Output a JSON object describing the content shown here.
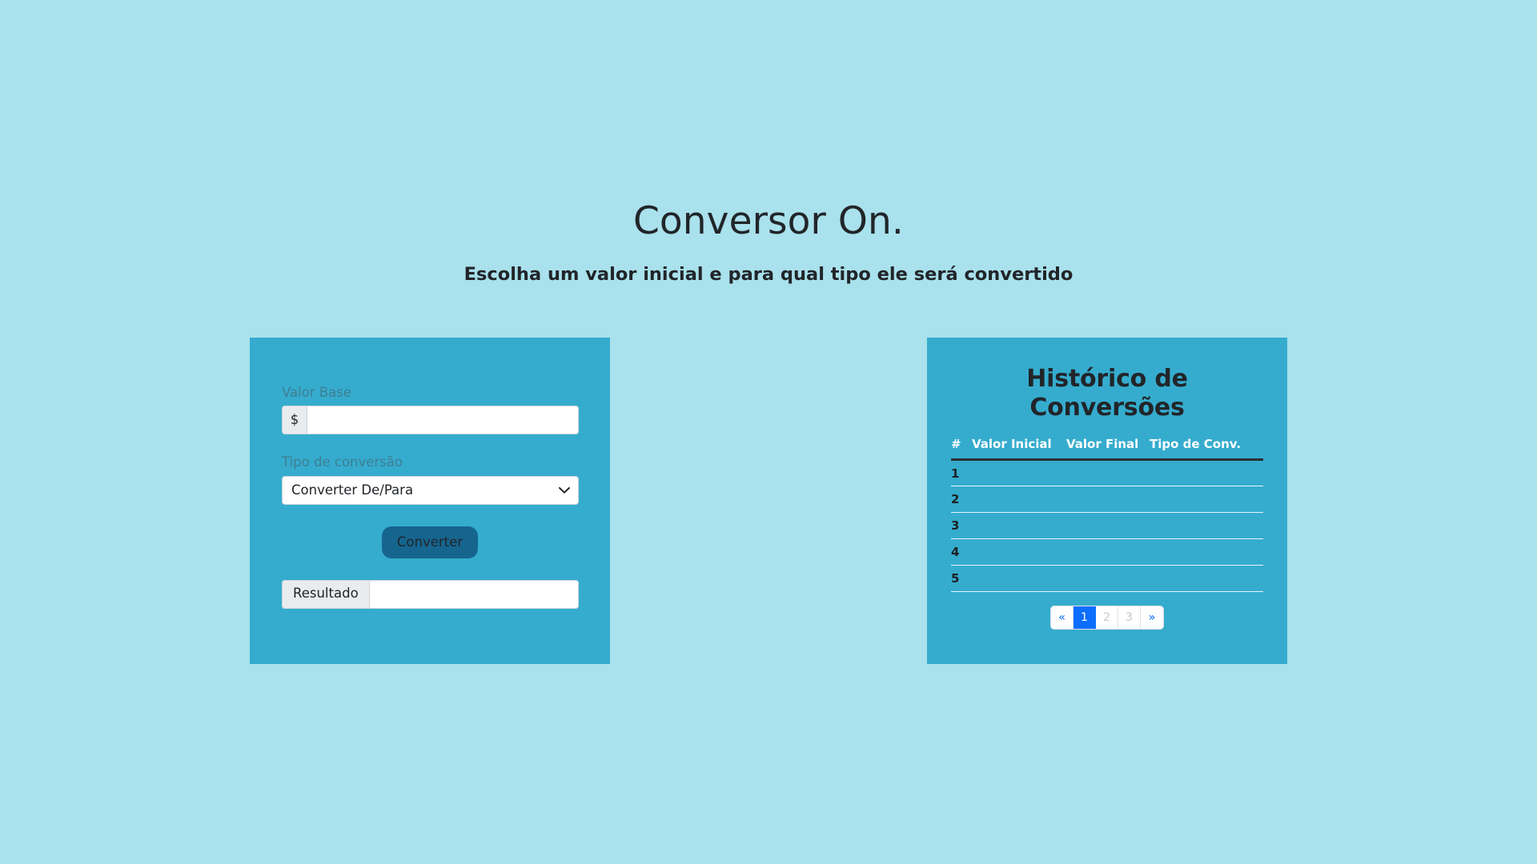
{
  "header": {
    "title": "Conversor On.",
    "subtitle": "Escolha um valor inicial e para qual tipo ele será convertido"
  },
  "form": {
    "base_value": {
      "label": "Valor Base",
      "currency_symbol": "$",
      "value": "",
      "placeholder": ""
    },
    "conversion_type": {
      "label": "Tipo de conversão",
      "selected": "Converter De/Para",
      "options": [
        "Converter De/Para"
      ]
    },
    "submit_label": "Converter",
    "result": {
      "label": "Resultado",
      "value": "",
      "placeholder": ""
    }
  },
  "history": {
    "title": "Histórico de Conversões",
    "columns": [
      "#",
      "Valor Inicial",
      "Valor Final",
      "Tipo de Conv."
    ],
    "rows": [
      {
        "index": "1",
        "valor_inicial": "",
        "valor_final": "",
        "tipo": ""
      },
      {
        "index": "2",
        "valor_inicial": "",
        "valor_final": "",
        "tipo": ""
      },
      {
        "index": "3",
        "valor_inicial": "",
        "valor_final": "",
        "tipo": ""
      },
      {
        "index": "4",
        "valor_inicial": "",
        "valor_final": "",
        "tipo": ""
      },
      {
        "index": "5",
        "valor_inicial": "",
        "valor_final": "",
        "tipo": ""
      }
    ],
    "pagination": {
      "prev": "«",
      "next": "»",
      "pages": [
        {
          "label": "1",
          "state": "active"
        },
        {
          "label": "2",
          "state": "disabled"
        },
        {
          "label": "3",
          "state": "disabled"
        }
      ]
    }
  },
  "colors": {
    "page_background": "#a9e1ec",
    "panel_background": "#35acce",
    "primary_button": "#15658f",
    "pagination_active": "#0d6efd",
    "label_text": "#3f7e93",
    "heading_text": "#212529"
  }
}
